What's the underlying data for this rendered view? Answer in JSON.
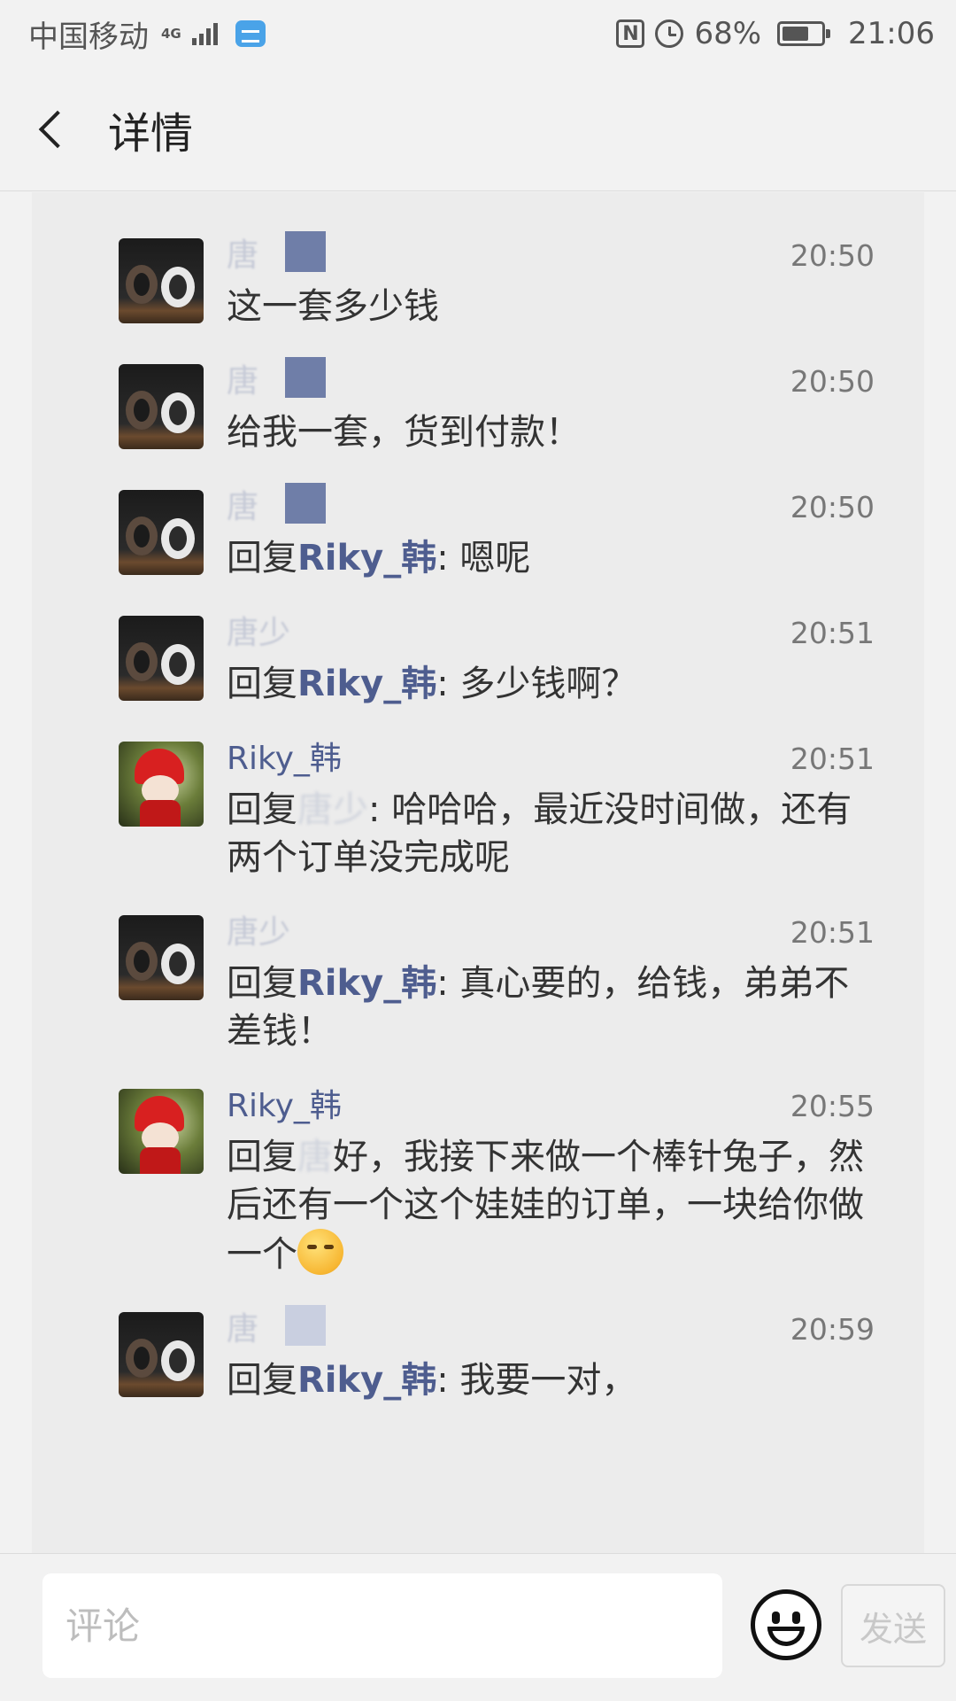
{
  "status_bar": {
    "carrier": "中国移动",
    "network": "4G",
    "battery": "68%",
    "time": "21:06"
  },
  "header": {
    "title": "详情"
  },
  "comments": [
    {
      "user": "唐",
      "time": "20:50",
      "text": "这一套多少钱"
    },
    {
      "user": "唐",
      "time": "20:50",
      "text": "给我一套，货到付款！"
    },
    {
      "user": "唐",
      "time": "20:50",
      "reply_prefix": "回复",
      "reply_to": "Riky_韩",
      "text": ": 嗯呢"
    },
    {
      "user": "唐少",
      "time": "20:51",
      "reply_prefix": "回复",
      "reply_to": "Riky_韩",
      "text": ": 多少钱啊？"
    },
    {
      "user": "Riky_韩",
      "time": "20:51",
      "reply_prefix": "回复",
      "reply_to": "唐少",
      "text": ": 哈哈哈，最近没时间做，还有两个订单没完成呢"
    },
    {
      "user": "唐少",
      "time": "20:51",
      "reply_prefix": "回复",
      "reply_to": "Riky_韩",
      "text": ": 真心要的，给钱，弟弟不差钱！"
    },
    {
      "user": "Riky_韩",
      "time": "20:55",
      "reply_prefix": "回复",
      "reply_to": "唐",
      "text": "好，我接下来做一个棒针兔子，然后还有一个这个娃娃的订单，一块给你做一个"
    },
    {
      "user": "唐",
      "time": "20:59",
      "reply_prefix": "回复",
      "reply_to": "Riky_韩",
      "text": ": 我要一对，"
    }
  ],
  "input_bar": {
    "placeholder": "评论",
    "send_label": "发送"
  }
}
